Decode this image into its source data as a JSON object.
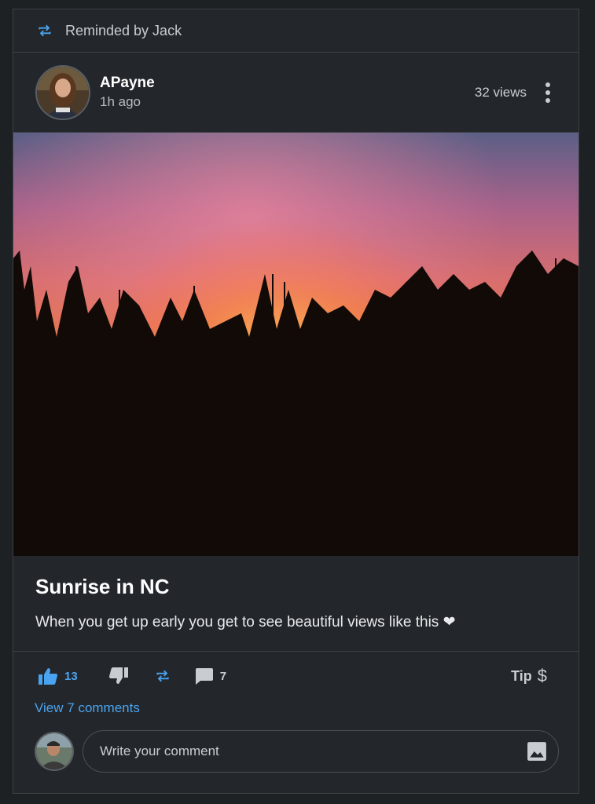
{
  "remind": {
    "text": "Reminded by Jack",
    "icon": "remind-icon"
  },
  "owner": {
    "name": "APayne",
    "time": "1h ago",
    "views": "32 views"
  },
  "post": {
    "title": "Sunrise in NC",
    "description": "When you get up early you get to see beautiful views like this ❤"
  },
  "actions": {
    "upvotes": "13",
    "comments": "7",
    "tip_label": "Tip",
    "tip_symbol": "$"
  },
  "comments_link": "View 7 comments",
  "composer": {
    "placeholder": "Write your comment"
  },
  "colors": {
    "accent": "#4aa3f0",
    "background": "#23272b",
    "border": "#3c4146"
  }
}
